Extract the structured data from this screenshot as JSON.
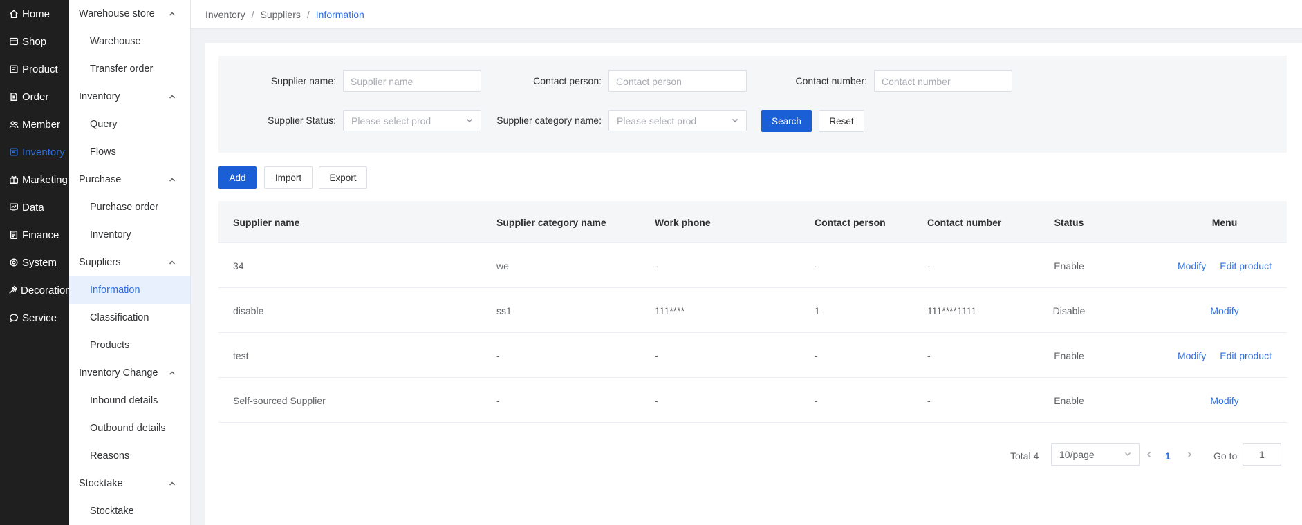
{
  "nav": [
    {
      "label": "Home",
      "icon": "home-icon"
    },
    {
      "label": "Shop",
      "icon": "shop-icon"
    },
    {
      "label": "Product",
      "icon": "product-icon"
    },
    {
      "label": "Order",
      "icon": "order-icon"
    },
    {
      "label": "Member",
      "icon": "member-icon"
    },
    {
      "label": "Inventory",
      "icon": "inventory-icon"
    },
    {
      "label": "Marketing",
      "icon": "marketing-icon"
    },
    {
      "label": "Data",
      "icon": "data-icon"
    },
    {
      "label": "Finance",
      "icon": "finance-icon"
    },
    {
      "label": "System",
      "icon": "system-icon"
    },
    {
      "label": "Decoration",
      "icon": "decoration-icon"
    },
    {
      "label": "Service",
      "icon": "service-icon"
    }
  ],
  "submenu": {
    "warehouse_store": {
      "label": "Warehouse store",
      "items": [
        "Warehouse",
        "Transfer order"
      ]
    },
    "inventory": {
      "label": "Inventory",
      "items": [
        "Query",
        "Flows"
      ]
    },
    "purchase": {
      "label": "Purchase",
      "items": [
        "Purchase order",
        "Inventory"
      ]
    },
    "suppliers": {
      "label": "Suppliers",
      "items": [
        "Information",
        "Classification",
        "Products"
      ]
    },
    "inventory_change": {
      "label": "Inventory Change",
      "items": [
        "Inbound details",
        "Outbound details",
        "Reasons"
      ]
    },
    "stocktake": {
      "label": "Stocktake",
      "items": [
        "Stocktake"
      ]
    }
  },
  "breadcrumb": {
    "a": "Inventory",
    "b": "Suppliers",
    "c": "Information",
    "sep": "/"
  },
  "filter": {
    "supplier_name_label": "Supplier name:",
    "supplier_name_placeholder": "Supplier name",
    "contact_person_label": "Contact person:",
    "contact_person_placeholder": "Contact person",
    "contact_number_label": "Contact number:",
    "contact_number_placeholder": "Contact number",
    "status_label": "Supplier Status:",
    "status_placeholder": "Please select prod",
    "category_label": "Supplier category name:",
    "category_placeholder": "Please select prod",
    "search": "Search",
    "reset": "Reset"
  },
  "actions": {
    "add": "Add",
    "import": "Import",
    "export": "Export"
  },
  "table": {
    "headers": {
      "name": "Supplier name",
      "category": "Supplier category name",
      "work_phone": "Work phone",
      "contact_person": "Contact person",
      "contact_number": "Contact number",
      "status": "Status",
      "menu": "Menu"
    },
    "rows": [
      {
        "name": "34",
        "category": "we",
        "work_phone": "-",
        "contact_person": "-",
        "contact_number": "-",
        "status": "Enable",
        "actions": [
          "Modify",
          "Edit product"
        ]
      },
      {
        "name": "disable",
        "category": "ss1",
        "work_phone": "111****",
        "contact_person": "1",
        "contact_number": "111****1111",
        "status": "Disable",
        "actions": [
          "Modify"
        ]
      },
      {
        "name": "test",
        "category": "-",
        "work_phone": "-",
        "contact_person": "-",
        "contact_number": "-",
        "status": "Enable",
        "actions": [
          "Modify",
          "Edit product"
        ]
      },
      {
        "name": "Self-sourced Supplier",
        "category": "-",
        "work_phone": "-",
        "contact_person": "-",
        "contact_number": "-",
        "status": "Enable",
        "actions": [
          "Modify"
        ]
      }
    ]
  },
  "pagination": {
    "total": "Total 4",
    "page_size": "10/page",
    "current": "1",
    "goto_label": "Go to",
    "goto_value": "1"
  },
  "colors": {
    "accent": "#2f6fe0",
    "primary_button": "#1a5fd6",
    "sidebar_bg": "#1f1f1f"
  }
}
